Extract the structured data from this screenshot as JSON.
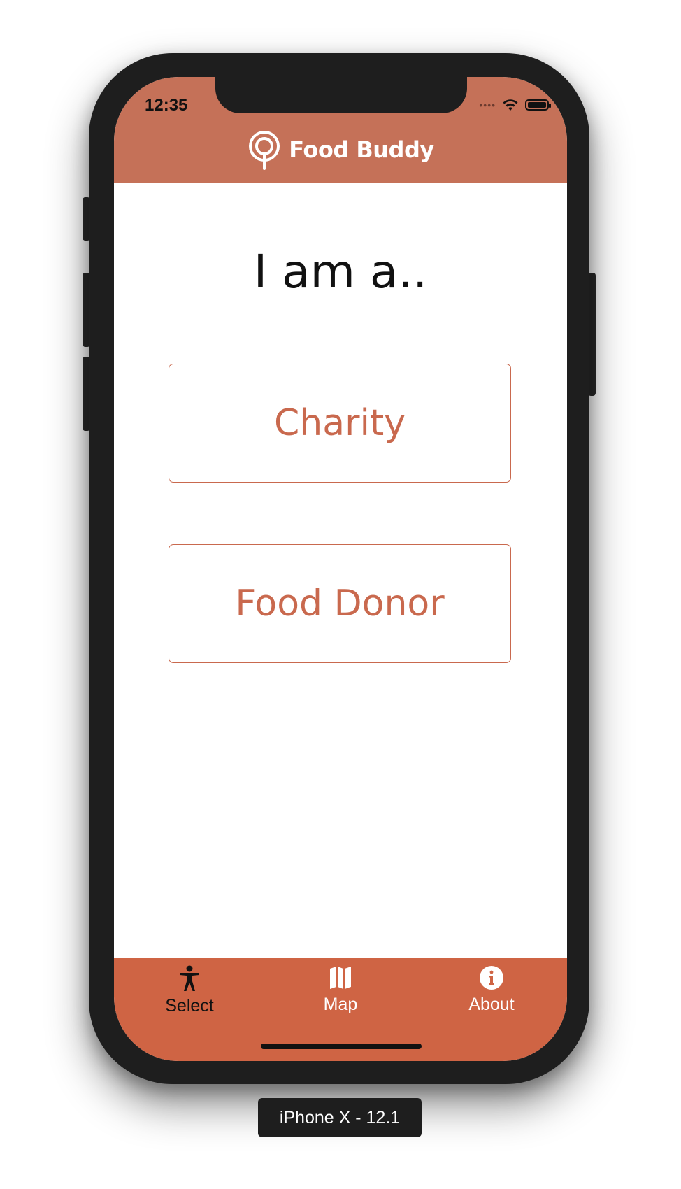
{
  "status_bar": {
    "time": "12:35"
  },
  "header": {
    "app_name": "Food Buddy",
    "logo_icon": "location-pin-icon",
    "color": "#c57158"
  },
  "main": {
    "title": "I am a..",
    "options": [
      {
        "label": "Charity"
      },
      {
        "label": "Food Donor"
      }
    ],
    "accent_color": "#c9694e"
  },
  "tabbar": {
    "color": "#cf6444",
    "tabs": [
      {
        "label": "Select",
        "icon": "accessibility-person-icon",
        "active": true
      },
      {
        "label": "Map",
        "icon": "map-icon",
        "active": false
      },
      {
        "label": "About",
        "icon": "info-icon",
        "active": false
      }
    ]
  },
  "simulator": {
    "device_label": "iPhone X - 12.1"
  }
}
